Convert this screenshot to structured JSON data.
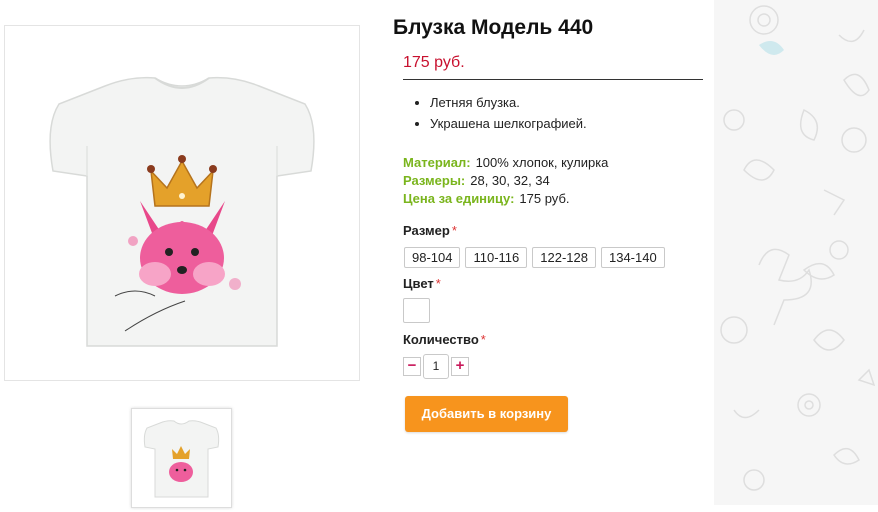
{
  "product": {
    "title": "Блузка Модель 440",
    "price": "175 руб.",
    "features": [
      "Летняя блузка.",
      "Украшена шелкографией."
    ],
    "specs": [
      {
        "key": "Материал:",
        "value": "100% хлопок, кулирка"
      },
      {
        "key": "Размеры:",
        "value": "28, 30, 32, 34"
      },
      {
        "key": "Цена за единицу:",
        "value": "175 руб."
      }
    ]
  },
  "options": {
    "size_label": "Размер",
    "sizes": [
      "98-104",
      "110-116",
      "122-128",
      "134-140"
    ],
    "color_label": "Цвет",
    "quantity_label": "Количество",
    "required_mark": "*",
    "quantity": "1",
    "minus": "−",
    "plus": "+"
  },
  "cart": {
    "add_label": "Добавить в корзину"
  },
  "colors": {
    "accent": "#7ab51d",
    "price": "#c8102e",
    "button": "#f7941d",
    "qty_sign": "#c8185a"
  }
}
